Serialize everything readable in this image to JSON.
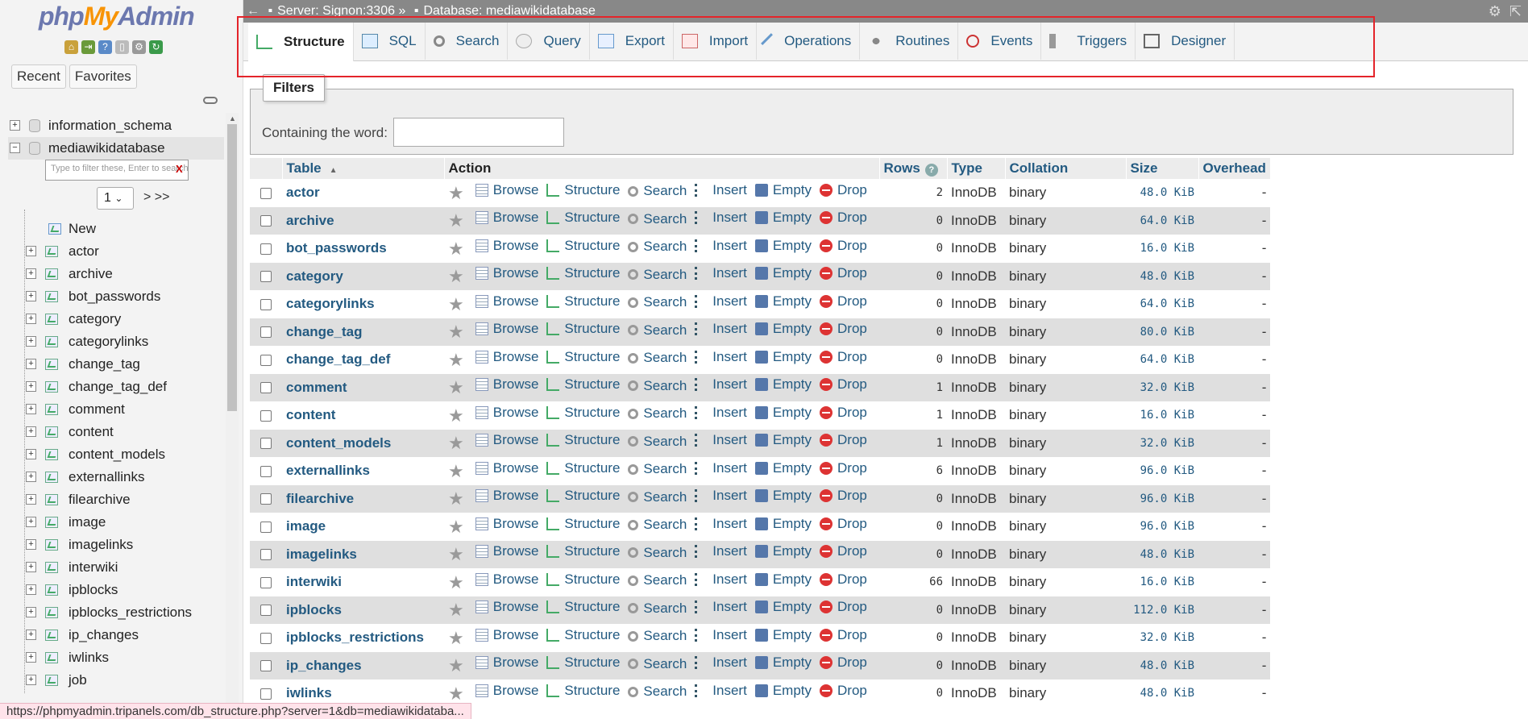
{
  "nav": {
    "logo_php": "php",
    "logo_my": "My",
    "logo_admin": "Admin",
    "recent": "Recent",
    "favorites": "Favorites",
    "filter_placeholder": "Type to filter these, Enter to search all",
    "filter_clear": "X",
    "page_value": "1",
    "page_next": "> >>",
    "databases": [
      {
        "name": "information_schema",
        "expanded": false
      },
      {
        "name": "mediawikidatabase",
        "expanded": true
      }
    ],
    "new_label": "New",
    "tables": [
      "actor",
      "archive",
      "bot_passwords",
      "category",
      "categorylinks",
      "change_tag",
      "change_tag_def",
      "comment",
      "content",
      "content_models",
      "externallinks",
      "filearchive",
      "image",
      "imagelinks",
      "interwiki",
      "ipblocks",
      "ipblocks_restrictions",
      "ip_changes",
      "iwlinks",
      "job"
    ]
  },
  "status_url": "https://phpmyadmin.tripanels.com/db_structure.php?server=1&db=mediawikidataba...",
  "breadcrumb": {
    "server": "Server: Signon:3306 »",
    "database": "Database: mediawikidatabase"
  },
  "tabs": [
    "Structure",
    "SQL",
    "Search",
    "Query",
    "Export",
    "Import",
    "Operations",
    "Routines",
    "Events",
    "Triggers",
    "Designer"
  ],
  "filters": {
    "legend": "Filters",
    "label": "Containing the word:"
  },
  "table": {
    "headers": {
      "table": "Table",
      "action": "Action",
      "rows": "Rows",
      "type": "Type",
      "collation": "Collation",
      "size": "Size",
      "overhead": "Overhead"
    },
    "actions": [
      "Browse",
      "Structure",
      "Search",
      "Insert",
      "Empty",
      "Drop"
    ],
    "rows": [
      {
        "name": "actor",
        "rows": "2",
        "type": "InnoDB",
        "collation": "binary",
        "size": "48.0 KiB",
        "overhead": "-"
      },
      {
        "name": "archive",
        "rows": "0",
        "type": "InnoDB",
        "collation": "binary",
        "size": "64.0 KiB",
        "overhead": "-"
      },
      {
        "name": "bot_passwords",
        "rows": "0",
        "type": "InnoDB",
        "collation": "binary",
        "size": "16.0 KiB",
        "overhead": "-"
      },
      {
        "name": "category",
        "rows": "0",
        "type": "InnoDB",
        "collation": "binary",
        "size": "48.0 KiB",
        "overhead": "-"
      },
      {
        "name": "categorylinks",
        "rows": "0",
        "type": "InnoDB",
        "collation": "binary",
        "size": "64.0 KiB",
        "overhead": "-"
      },
      {
        "name": "change_tag",
        "rows": "0",
        "type": "InnoDB",
        "collation": "binary",
        "size": "80.0 KiB",
        "overhead": "-"
      },
      {
        "name": "change_tag_def",
        "rows": "0",
        "type": "InnoDB",
        "collation": "binary",
        "size": "64.0 KiB",
        "overhead": "-"
      },
      {
        "name": "comment",
        "rows": "1",
        "type": "InnoDB",
        "collation": "binary",
        "size": "32.0 KiB",
        "overhead": "-"
      },
      {
        "name": "content",
        "rows": "1",
        "type": "InnoDB",
        "collation": "binary",
        "size": "16.0 KiB",
        "overhead": "-"
      },
      {
        "name": "content_models",
        "rows": "1",
        "type": "InnoDB",
        "collation": "binary",
        "size": "32.0 KiB",
        "overhead": "-"
      },
      {
        "name": "externallinks",
        "rows": "6",
        "type": "InnoDB",
        "collation": "binary",
        "size": "96.0 KiB",
        "overhead": "-"
      },
      {
        "name": "filearchive",
        "rows": "0",
        "type": "InnoDB",
        "collation": "binary",
        "size": "96.0 KiB",
        "overhead": "-"
      },
      {
        "name": "image",
        "rows": "0",
        "type": "InnoDB",
        "collation": "binary",
        "size": "96.0 KiB",
        "overhead": "-"
      },
      {
        "name": "imagelinks",
        "rows": "0",
        "type": "InnoDB",
        "collation": "binary",
        "size": "48.0 KiB",
        "overhead": "-"
      },
      {
        "name": "interwiki",
        "rows": "66",
        "type": "InnoDB",
        "collation": "binary",
        "size": "16.0 KiB",
        "overhead": "-"
      },
      {
        "name": "ipblocks",
        "rows": "0",
        "type": "InnoDB",
        "collation": "binary",
        "size": "112.0 KiB",
        "overhead": "-"
      },
      {
        "name": "ipblocks_restrictions",
        "rows": "0",
        "type": "InnoDB",
        "collation": "binary",
        "size": "32.0 KiB",
        "overhead": "-"
      },
      {
        "name": "ip_changes",
        "rows": "0",
        "type": "InnoDB",
        "collation": "binary",
        "size": "48.0 KiB",
        "overhead": "-"
      },
      {
        "name": "iwlinks",
        "rows": "0",
        "type": "InnoDB",
        "collation": "binary",
        "size": "48.0 KiB",
        "overhead": "-"
      }
    ]
  },
  "colors": {
    "link": "#235a81",
    "highlight_box": "#e4242a",
    "topbar": "#888888"
  }
}
